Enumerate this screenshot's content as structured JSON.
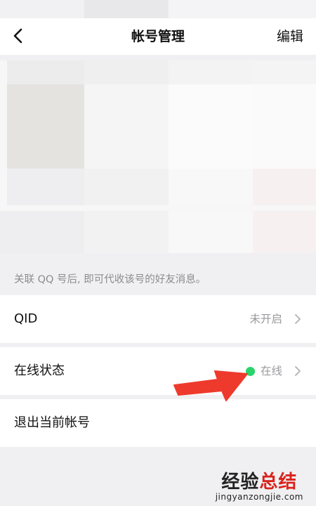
{
  "header": {
    "title": "帐号管理",
    "edit_label": "编辑",
    "back_icon": "chevron-left-icon"
  },
  "linked_accounts": {
    "hint": "关联 QQ 号后, 即可代收该号的好友消息。"
  },
  "settings": {
    "qid": {
      "label": "QID",
      "value": "未开启"
    },
    "online_status": {
      "label": "在线状态",
      "value": "在线",
      "dot_color": "#2bd46b"
    },
    "logout": {
      "label": "退出当前帐号"
    }
  },
  "annotation": {
    "arrow_color": "#ee3a2c"
  },
  "watermark": {
    "main_prefix": "经验",
    "main_accent": "总结",
    "sub": "jingyanzongjie.com"
  }
}
